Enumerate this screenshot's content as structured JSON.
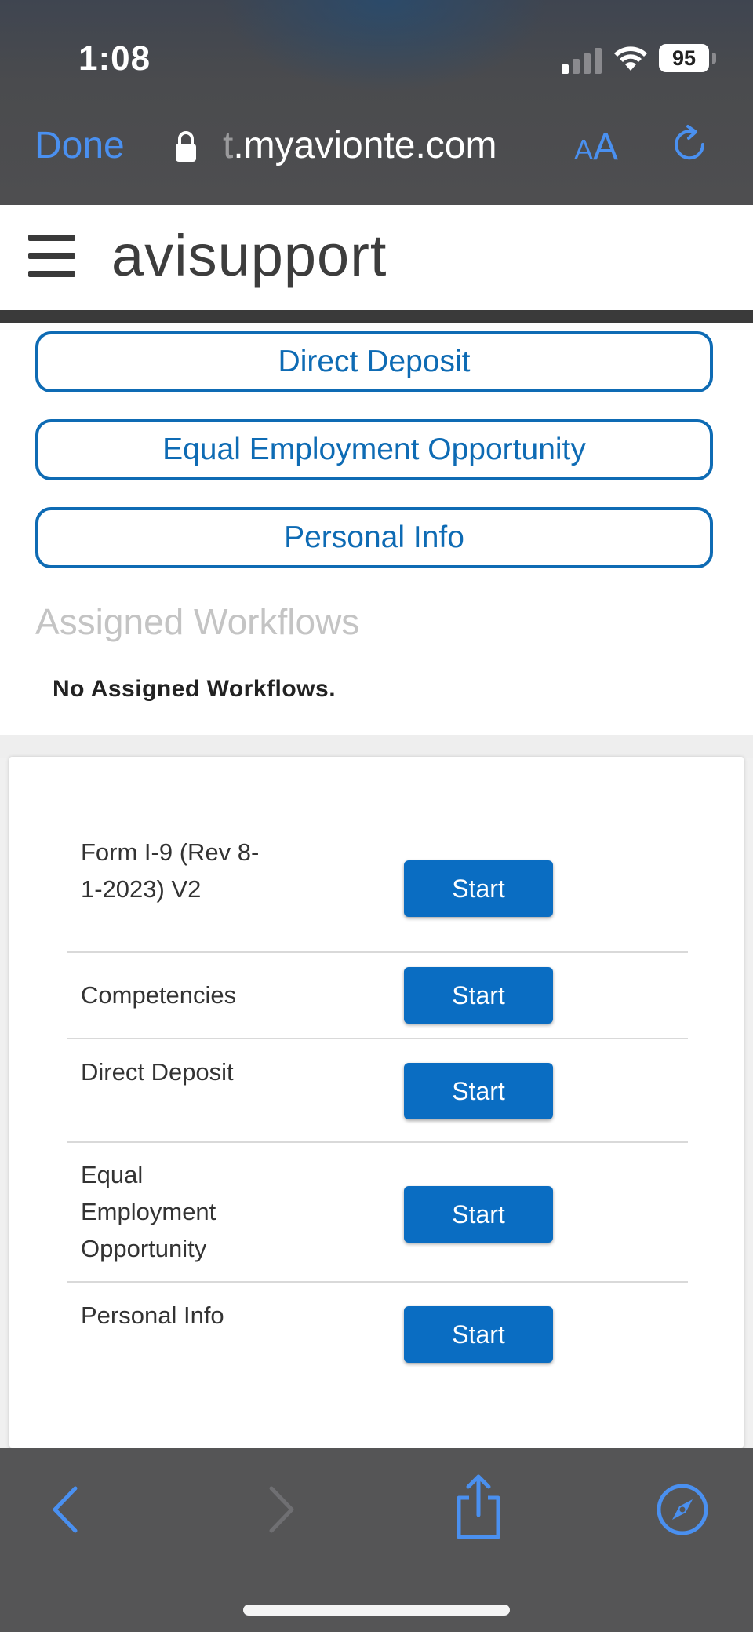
{
  "status_bar": {
    "time": "1:08",
    "battery": "95"
  },
  "browser": {
    "done_label": "Done",
    "url_fade": "t",
    "url_main": ".myavionte.com",
    "text_size_small": "A",
    "text_size_large": "A",
    "accent_color": "#4a90f0"
  },
  "header": {
    "title": "avisupport"
  },
  "nav_buttons": [
    {
      "label": "Direct Deposit"
    },
    {
      "label": "Equal Employment Opportunity"
    },
    {
      "label": "Personal Info"
    }
  ],
  "assigned_workflows": {
    "title": "Assigned Workflows",
    "empty_message": "No Assigned Workflows."
  },
  "forms": [
    {
      "name": "Form I-9 (Rev 8-1-2023) V2",
      "button": "Start"
    },
    {
      "name": "Competencies",
      "button": "Start"
    },
    {
      "name": "Direct Deposit",
      "button": "Start"
    },
    {
      "name": "Equal Employment Opportunity",
      "button": "Start"
    },
    {
      "name": "Personal Info",
      "button": "Start"
    }
  ],
  "colors": {
    "brand_blue": "#0e6bb4",
    "button_blue": "#0a6dc2"
  },
  "toolbar": {
    "icons": [
      "back-icon",
      "forward-icon",
      "share-icon",
      "compass-icon"
    ]
  }
}
